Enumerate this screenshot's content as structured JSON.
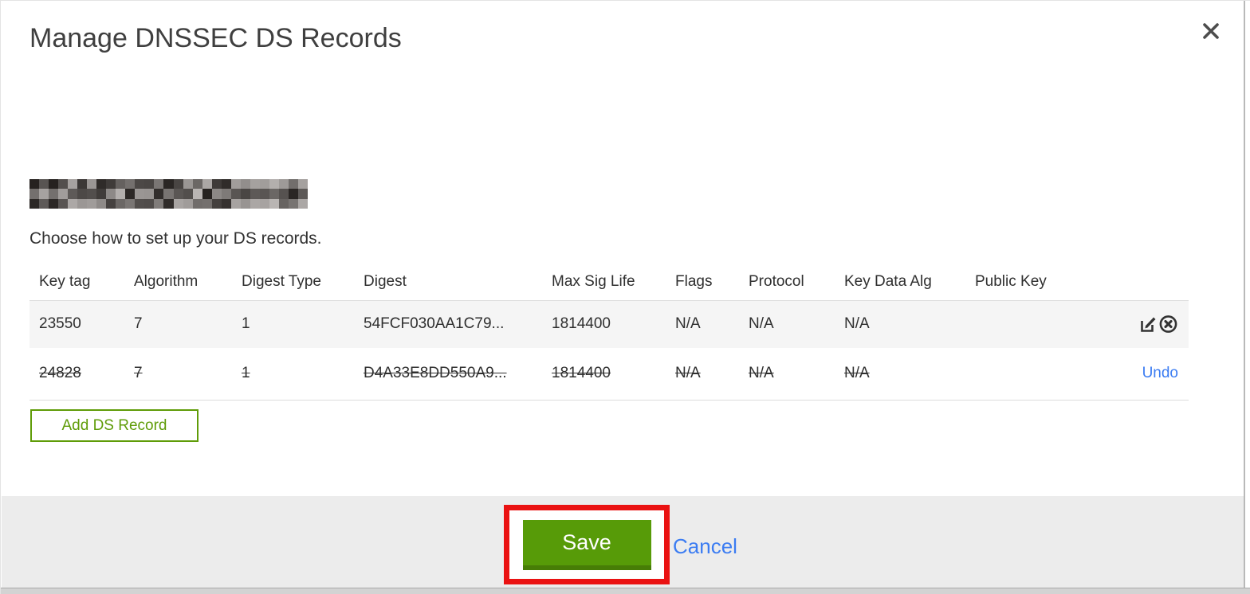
{
  "modal": {
    "title": "Manage DNSSEC DS Records",
    "instruction": "Choose how to set up your DS records.",
    "add_button_label": "Add DS Record",
    "save_label": "Save",
    "cancel_label": "Cancel",
    "undo_label": "Undo"
  },
  "table": {
    "columns": [
      "Key tag",
      "Algorithm",
      "Digest Type",
      "Digest",
      "Max Sig Life",
      "Flags",
      "Protocol",
      "Key Data Alg",
      "Public Key"
    ],
    "rows": [
      {
        "key_tag": "23550",
        "algorithm": "7",
        "digest_type": "1",
        "digest": "54FCF030AA1C79...",
        "max_sig_life": "1814400",
        "flags": "N/A",
        "protocol": "N/A",
        "key_data_alg": "N/A",
        "public_key": "",
        "state": "active"
      },
      {
        "key_tag": "24828",
        "algorithm": "7",
        "digest_type": "1",
        "digest": "D4A33E8DD550A9...",
        "max_sig_life": "1814400",
        "flags": "N/A",
        "protocol": "N/A",
        "key_data_alg": "N/A",
        "public_key": "",
        "state": "marked-for-deletion"
      }
    ]
  },
  "colors": {
    "green_accent": "#5f9c08",
    "save_green": "#579b08",
    "save_green_dark": "#477d06",
    "link_blue": "#3b7cf2",
    "annotation_red": "#ea1212",
    "footer_gray": "#ececec",
    "row_gray": "#f5f5f5",
    "text_dark": "#333333"
  }
}
